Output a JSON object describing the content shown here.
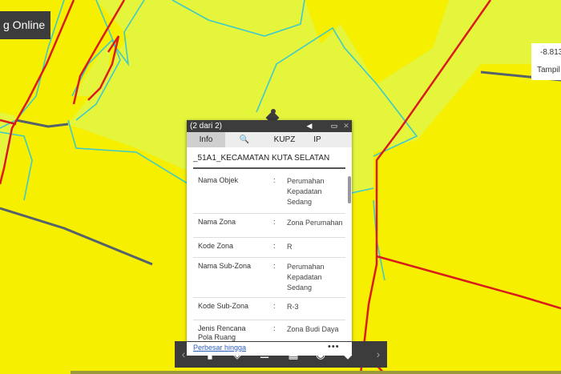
{
  "app": {
    "title": "g Online"
  },
  "coordinates": {
    "value": "-8.813",
    "label": "Tampil"
  },
  "map": {
    "colors": {
      "zone_yellow": "#f6ef00",
      "zone_light": "#e4f53c",
      "road_red": "#d91b1b",
      "parcel_outline": "#3fc9c9"
    }
  },
  "popup": {
    "count_text": "(2 dari 2)",
    "controls": {
      "prev": "◀",
      "maximize": "▭",
      "close": "✕"
    },
    "tabs": [
      {
        "label": "Info",
        "active": true
      },
      {
        "label": "🔍",
        "icon": "search-icon"
      },
      {
        "label": "KUPZ"
      },
      {
        "label": "IP"
      }
    ],
    "layer_title": "_51A1_KECAMATAN KUTA SELATAN",
    "attributes": [
      {
        "key": "Nama Objek",
        "sep": ":",
        "value": "Perumahan Kepadatan Sedang"
      },
      {
        "key": "Nama Zona",
        "sep": ":",
        "value": "Zona Perumahan"
      },
      {
        "key": "Kode Zona",
        "sep": ":",
        "value": "R"
      },
      {
        "key": "Nama Sub-Zona",
        "sep": ":",
        "value": "Perumahan Kepadatan Sedang"
      },
      {
        "key": "Kode Sub-Zona",
        "sep": ":",
        "value": "R-3"
      },
      {
        "key": "Jenis Rencana Pola Ruang",
        "sep": ":",
        "value": "Zona Budi Daya"
      }
    ],
    "zoom_link": "Perbesar hingga",
    "more": "•••"
  },
  "toolbar": {
    "tools": [
      "bookmark-icon",
      "layers-icon",
      "legend-icon",
      "basemap-icon",
      "locate-icon",
      "measure-icon"
    ]
  }
}
